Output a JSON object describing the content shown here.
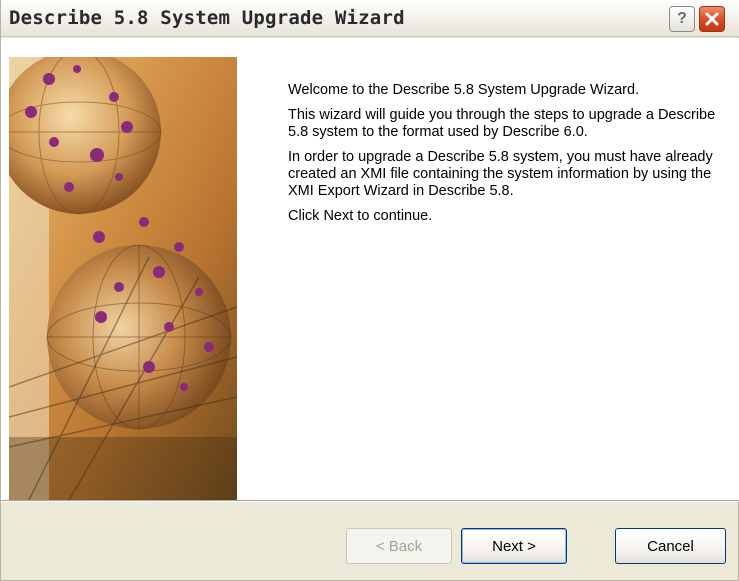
{
  "window": {
    "title": "Describe 5.8 System Upgrade Wizard",
    "help_label": "?",
    "close_icon": "close-icon"
  },
  "welcome": {
    "heading": "Welcome to the  Describe 5.8 System Upgrade Wizard.",
    "paragraph1": "This wizard will guide you through the steps to upgrade a Describe 5.8 system to the format used by Describe 6.0.",
    "paragraph2": "In order to upgrade a Describe 5.8 system, you must have already created an XMI file containing the system information by using the XMI Export Wizard in Describe 5.8.",
    "paragraph3": "Click Next to continue."
  },
  "buttons": {
    "back_label": "< Back",
    "next_label": "Next >",
    "cancel_label": "Cancel"
  },
  "colors": {
    "titlebar": "#f4f3ee",
    "dialog_bg": "#ece9d8",
    "close_red": "#d84a26",
    "art_orange": "#c58a40",
    "art_purple": "#8a2a7a"
  }
}
